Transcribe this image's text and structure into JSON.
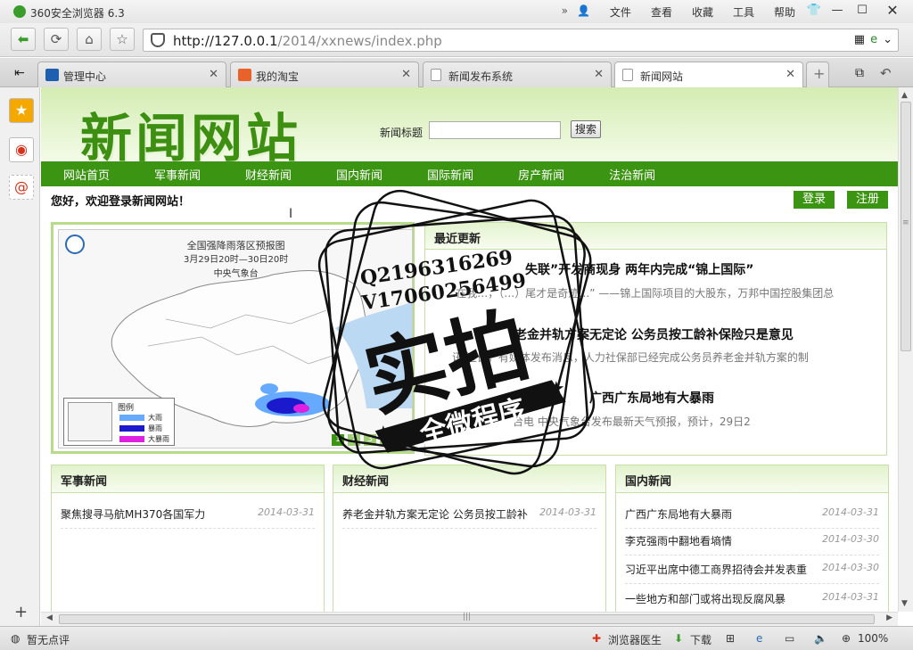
{
  "window": {
    "title": "360安全浏览器 6.3",
    "menu": [
      "文件",
      "查看",
      "收藏",
      "工具",
      "帮助"
    ]
  },
  "addressbar": {
    "url_host": "http://127.0.0.1",
    "url_path": "/2014/xxnews/index.php"
  },
  "tabs": [
    {
      "label": "管理中心",
      "color": "#1f5fb0"
    },
    {
      "label": "我的淘宝",
      "color": "#e8622a"
    },
    {
      "label": "新闻发布系统",
      "color": "#cccccc"
    },
    {
      "label": "新闻网站",
      "color": "#cccccc",
      "active": true
    }
  ],
  "site": {
    "logo": "新闻网站",
    "search_label": "新闻标题",
    "search_button": "搜索",
    "nav": [
      "网站首页",
      "军事新闻",
      "财经新闻",
      "国内新闻",
      "国际新闻",
      "房产新闻",
      "法治新闻"
    ],
    "welcome": "您好，欢迎登录新闻网站！",
    "login": "登录",
    "register": "注册"
  },
  "slider": {
    "map_title_1": "全国强降雨落区预报图",
    "map_title_2": "3月29日20时—30日20时",
    "map_title_3": "中央气象台",
    "legend_title": "图例",
    "legend": [
      {
        "label": "大雨",
        "color": "#66aaff"
      },
      {
        "label": "暴雨",
        "color": "#1a1acc"
      },
      {
        "label": "大暴雨",
        "color": "#e020e0"
      }
    ],
    "pages": [
      "1",
      "2",
      "3",
      "4",
      "5"
    ]
  },
  "latest": {
    "title": "最近更新",
    "items": [
      {
        "title": "失联”开发商现身 两年内完成“锦上国际”",
        "summary": "“在我…，（…）尾才是奇迹…”        ——锦上国际项目的大股东，万邦中国控股集团总"
      },
      {
        "title": "老金并轨方案无定论 公务员按工龄补保险只是意见",
        "summary": "讯 近日，有媒体发布消息，人力社保部已经完成公务员养老金并轨方案的制"
      },
      {
        "title": "广西广东局地有大暴雨",
        "summary": "台电 中央气象台发布最新天气预报，预计，29日2"
      }
    ]
  },
  "columns": [
    {
      "title": "军事新闻",
      "rows": [
        {
          "title": "聚焦搜寻马航MH370各国军力",
          "date": "2014-03-31"
        }
      ]
    },
    {
      "title": "财经新闻",
      "rows": [
        {
          "title": "养老金并轨方案无定论 公务员按工龄补",
          "date": "2014-03-31"
        }
      ]
    },
    {
      "title": "国内新闻",
      "rows": [
        {
          "title": "广西广东局地有大暴雨",
          "date": "2014-03-31"
        },
        {
          "title": "李克强雨中翻地看墒情",
          "date": "2014-03-30"
        },
        {
          "title": "习近平出席中德工商界招待会并发表重",
          "date": "2014-03-30"
        },
        {
          "title": "一些地方和部门或将出现反腐风暴",
          "date": "2014-03-31"
        }
      ]
    }
  ],
  "watermark": {
    "line1": "Q2196316269",
    "line2": "V17060256499",
    "big": "实拍",
    "banner": "全微程序"
  },
  "statusbar": {
    "comment": "暂无点评",
    "doctor": "浏览器医生",
    "download": "下载",
    "zoom": "100%"
  }
}
